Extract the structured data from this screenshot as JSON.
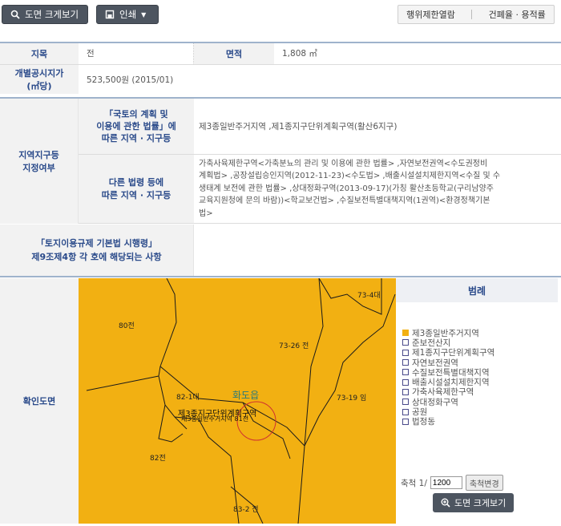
{
  "toolbar": {
    "enlarge_label": "도면 크게보기",
    "print_label": "인쇄",
    "restriction_label": "행위제한열람",
    "ratio_label": "건폐율 · 용적률"
  },
  "land": {
    "jimok_label": "지목",
    "jimok_value": "전",
    "area_label": "면적",
    "area_value": "1,808 ㎡",
    "price_label_1": "개별공시지가",
    "price_label_2": "(㎡당)",
    "price_value": "523,500원 (2015/01)"
  },
  "zoning": {
    "section_label_1": "지역지구등",
    "section_label_2": "지정여부",
    "law1_label_1": "「국토의 계획 및",
    "law1_label_2": "이용에 관한 법률」에",
    "law1_label_3": "따른 지역 · 지구등",
    "law1_value": "제3종일반주거지역 ,제1종지구단위계획구역(활산6지구)",
    "law2_label_1": "다른 법령 등에",
    "law2_label_2": "따른 지역 · 지구등",
    "law2_value_1": "가축사육제한구역<가축분뇨의 관리 및 이용에 관한 법률> ,자연보전권역<수도권정비",
    "law2_value_2": "계획법> ,공장설립승인지역(2012-11-23)<수도법> ,배출시설설치제한지역<수질 및 수",
    "law2_value_3": "생태계 보전에 관한 법률> ,상대정화구역(2013-09-17)(가칭 활산초등학교(구리남양주",
    "law2_value_4": "교육지원청에 문의 바람))<학교보건법> ,수질보전특별대책지역(1권역)<환경정책기본",
    "law2_value_5": "법>"
  },
  "regulation": {
    "label_1": "「토지이용규제 기본법 시행령」",
    "label_2": "제9조제4항 각 호에 해당되는 사항",
    "value": ""
  },
  "confirm": {
    "label": "확인도면"
  },
  "map": {
    "parcels": [
      "73-4대",
      "80전",
      "73-26 전",
      "82-1대",
      "73-19 임",
      "82전",
      "83-2 전"
    ],
    "town": "화도읍",
    "overlay_1": "제3종지구단위계획구역",
    "overlay_2": "제3종일반주거지역 81전"
  },
  "legend": {
    "title": "범례",
    "items": [
      {
        "label": "제3종일반주거지역",
        "color": "#f2b012"
      },
      {
        "label": "준보전산지",
        "color": "#ffffff"
      },
      {
        "label": "제1종지구단위계획구역",
        "color": "#ffffff"
      },
      {
        "label": "자연보전권역",
        "color": "#ffffff"
      },
      {
        "label": "수질보전특별대책지역",
        "color": "#ffffff"
      },
      {
        "label": "배출시설설치제한지역",
        "color": "#ffffff"
      },
      {
        "label": "가축사육제한구역",
        "color": "#ffffff"
      },
      {
        "label": "상대정화구역",
        "color": "#ffffff"
      },
      {
        "label": "공원",
        "color": "#ffffff"
      },
      {
        "label": "법정동",
        "color": "#ffffff"
      }
    ],
    "scale_label": "축척 1/",
    "scale_value": "1200",
    "scale_apply": "축척변경",
    "enlarge_label": "도면 크게보기"
  }
}
